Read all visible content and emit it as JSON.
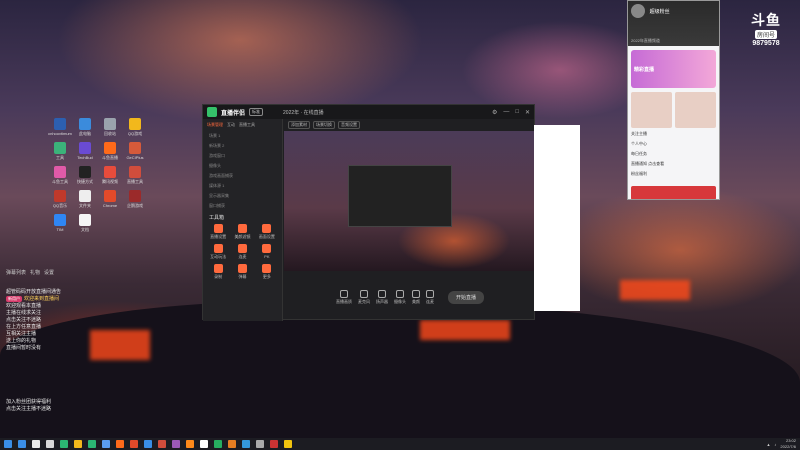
{
  "desktop": {
    "icons": [
      {
        "label": "cnhoovtimum",
        "color": "#2c5fb0"
      },
      {
        "label": "此电脑",
        "color": "#3b8bdc"
      },
      {
        "label": "回收站",
        "color": "#9aa3ad"
      },
      {
        "label": "QQ游戏",
        "color": "#f2b81c"
      },
      {
        "label": "工具",
        "color": "#3bb37a"
      },
      {
        "label": "TechBud",
        "color": "#6a4bd3"
      },
      {
        "label": "斗鱼直播",
        "color": "#ff6a1a"
      },
      {
        "label": "GeCIPlus",
        "color": "#d65a3a"
      },
      {
        "label": "斗鱼工具",
        "color": "#e05aa8"
      },
      {
        "label": "快捷方式",
        "color": "#222222"
      },
      {
        "label": "腾讯视频",
        "color": "#e74c3c"
      },
      {
        "label": "直播工具",
        "color": "#d04d3c"
      },
      {
        "label": "QQ音乐",
        "color": "#c0392b"
      },
      {
        "label": "文件夹",
        "color": "#eeeeee"
      },
      {
        "label": "Chrome",
        "color": "#e34a2a"
      },
      {
        "label": "企鹅游戏",
        "color": "#9b2a2a"
      },
      {
        "label": "TIM",
        "color": "#2f86f4"
      },
      {
        "label": "文档",
        "color": "#f5f5f5"
      }
    ]
  },
  "chat": {
    "bar_items": [
      "弹幕列表",
      "礼物",
      "设置"
    ],
    "lines": [
      {
        "text": "超管码码开放直播间通告",
        "badge": "",
        "hl": ""
      },
      {
        "text": "欢迎来到直播间",
        "badge": "新用户",
        "hl": "欢迎来到"
      },
      {
        "text": "欢迎观看本直播",
        "badge": "",
        "hl": ""
      },
      {
        "text": "主播在线求关注",
        "badge": "",
        "hl": ""
      },
      {
        "text": "点击关注不迷路",
        "badge": "",
        "hl": ""
      },
      {
        "text": "在上方任意直播",
        "badge": "",
        "hl": ""
      },
      {
        "text": "互相关注主播",
        "badge": "",
        "hl": ""
      },
      {
        "text": "送上你的礼物",
        "badge": "",
        "hl": ""
      },
      {
        "text": "直播间暂时没有",
        "badge": "",
        "hl": ""
      }
    ],
    "bottom_lines": [
      "加入粉丝团获得福利",
      "点击关注主播不迷路"
    ]
  },
  "app": {
    "title": "直播伴侣",
    "badge": "标准",
    "status": "2022年 · 在线直播",
    "side_tabs": [
      "场景管理",
      "互动",
      "直播工具"
    ],
    "scenes": [
      "场景 1",
      "新场景 2",
      "游戏窗口",
      "摄像头",
      "游戏画面捕获",
      "媒体源 1",
      "显示器采集",
      "窗口捕获"
    ],
    "tools_title": "工具箱",
    "tools": [
      "直播设置",
      "美颜滤镜",
      "画面设置",
      "互动玩法",
      "连麦",
      "PK",
      "录制",
      "弹幕",
      "更多"
    ],
    "toolbar": [
      "添加素材",
      "场景切换",
      "音频设置"
    ],
    "bottom": [
      "直播画质",
      "麦克风",
      "扬声器",
      "摄像头",
      "美颜",
      "连麦"
    ],
    "live_button": "开始直播"
  },
  "qq": {
    "name": "超级粉丝",
    "subtitle": "2022年直播频道",
    "banner": "精彩直播",
    "items": [
      "关注主播",
      "个人中心",
      "每日任务",
      "直播通知 点击查看",
      "粉丝福利"
    ]
  },
  "douyu": {
    "logo": "斗鱼",
    "room_label": "房间号",
    "room_number": "9879578"
  },
  "taskbar": {
    "time": "23:02",
    "date": "2022/7/6",
    "icon_colors": [
      "#3a8ee6",
      "#eaeaea",
      "#d9d9d9",
      "#2bb673",
      "#f2b81c",
      "#2bb673",
      "#5a9cf0",
      "#ff6a1a",
      "#e34a2a",
      "#3a8ee6",
      "#d04d3c",
      "#9b59b6",
      "#ff8a1a",
      "#ffffff",
      "#27ae60",
      "#e67e22",
      "#3498db",
      "#aaaaaa",
      "#cc3333",
      "#f1c40f"
    ]
  }
}
